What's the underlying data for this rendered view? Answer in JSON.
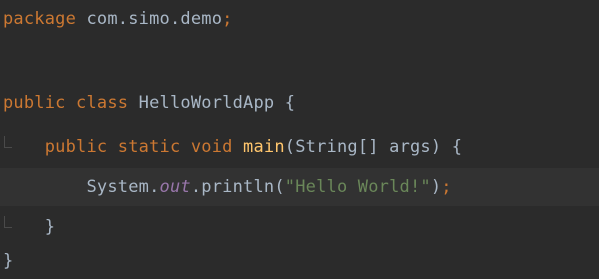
{
  "editor": {
    "lines": [
      {
        "segments": [
          "package",
          " com.simo.demo",
          ";"
        ]
      },
      {
        "segments": []
      },
      {
        "segments": [
          "public",
          " ",
          "class",
          " HelloWorldApp {"
        ]
      },
      {
        "segments": [
          "    ",
          "public",
          " ",
          "static",
          " ",
          "void",
          " ",
          "main",
          "(String[] args) {"
        ]
      },
      {
        "segments": [
          "        System.",
          "out",
          ".println(",
          "\"Hello World!\"",
          ")",
          ";"
        ]
      },
      {
        "segments": [
          "    }"
        ]
      },
      {
        "segments": [
          "}"
        ]
      }
    ]
  },
  "colors": {
    "background": "#2b2b2b",
    "current_line": "#323232",
    "keyword": "#cc7832",
    "text": "#a9b7c6",
    "method": "#ffc66d",
    "static_field": "#9876aa",
    "string": "#6a8759"
  }
}
